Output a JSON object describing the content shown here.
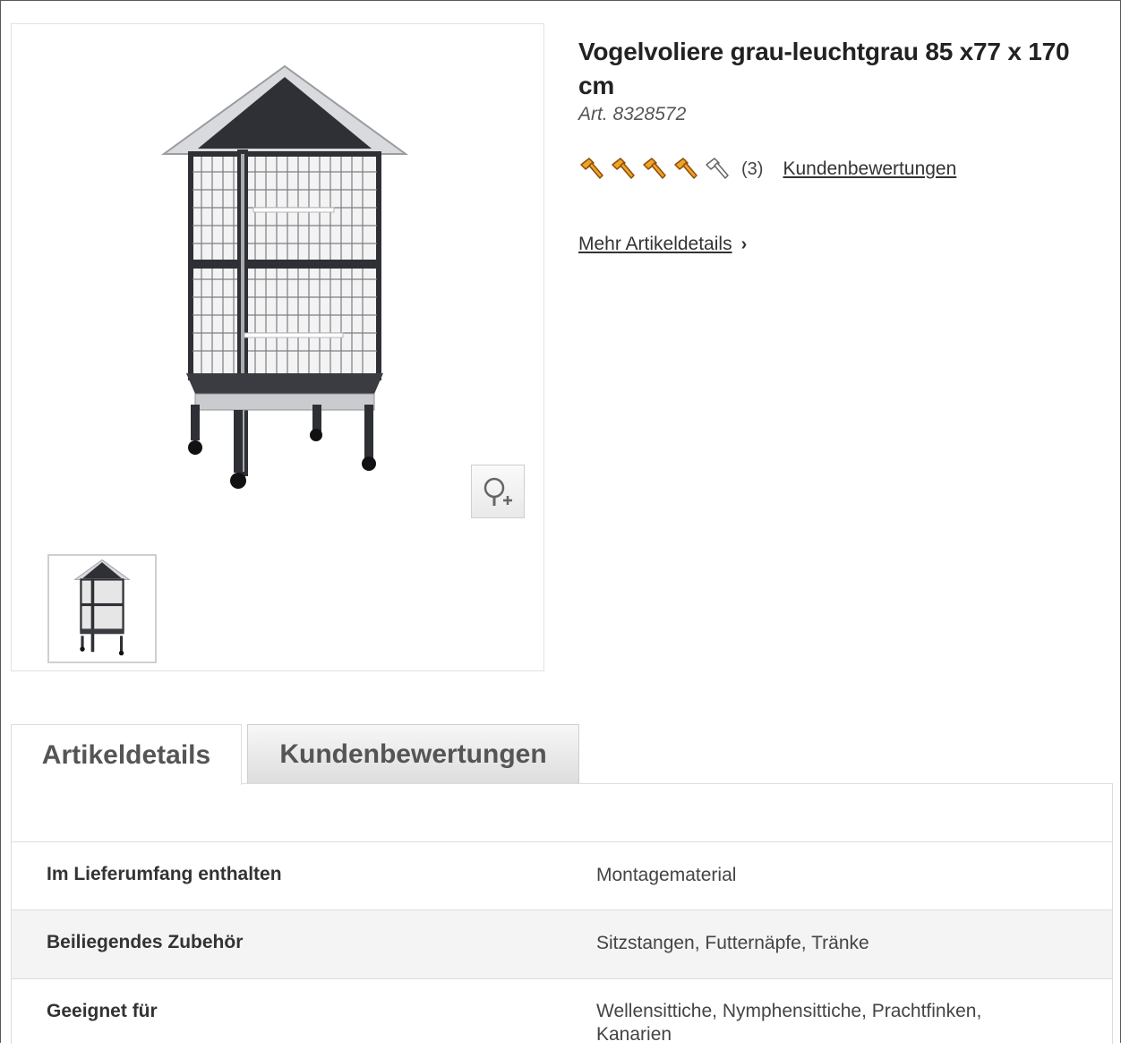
{
  "product": {
    "title": "Vogelvoliere grau-leuchtgrau 85 x77 x 170 cm",
    "article_number": "Art. 8328572",
    "rating": {
      "filled": 4,
      "total": 5,
      "count": "(3)",
      "reviews_link": "Kundenbewertungen"
    },
    "more_details": "Mehr Artikeldetails",
    "more_details_chevron": "›"
  },
  "gallery": {
    "main_image": "bird-aviary-cage-image",
    "zoom_icon": "zoom-in-icon",
    "thumbnails": [
      "bird-aviary-cage-thumbnail"
    ]
  },
  "tabs": [
    {
      "label": "Artikeldetails",
      "active": true
    },
    {
      "label": "Kundenbewertungen",
      "active": false
    }
  ],
  "details": [
    {
      "label": "Im Lieferumfang enthalten",
      "value": "Montagematerial"
    },
    {
      "label": "Beiliegendes Zubehör",
      "value": "Sitzstangen, Futternäpfe, Tränke"
    },
    {
      "label": "Geeignet für",
      "value": "Wellensittiche, Nymphensittiche, Prachtfinken, Kanarien"
    }
  ],
  "colors": {
    "rating_orange": "#f0a22a",
    "cage_dark": "#2e3036",
    "border": "#dcdcdc"
  }
}
